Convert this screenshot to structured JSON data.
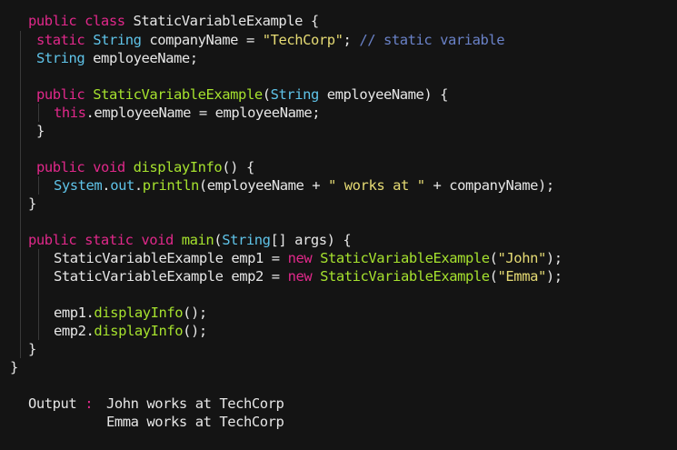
{
  "colors": {
    "background": "#141414",
    "keyword": "#e0288a",
    "type": "#5fc3e8",
    "function": "#a6e22e",
    "string": "#e6db74",
    "comment": "#6a82c8",
    "default_text": "#e6e6e6"
  },
  "code": {
    "l1": {
      "kw": "public class",
      "name": " StaticVariableExample {"
    },
    "l2": {
      "kw": "static",
      "ty": "String",
      "rest": " companyName = ",
      "str": "\"TechCorp\"",
      "semi": "; ",
      "comment": "// static variable"
    },
    "l3": {
      "ty": "String",
      "rest": " employeeName;"
    },
    "l4": {
      "kw": "public",
      "fn": "StaticVariableExample",
      "p1": "(",
      "ty": "String",
      "p2": " employeeName) {"
    },
    "l5": {
      "kw": "this",
      "rest": ".employeeName = employeeName;"
    },
    "l6": {
      "rest": "}"
    },
    "l7": {
      "kw": "public void",
      "fn": "displayInfo",
      "rest": "() {"
    },
    "l8": {
      "ty1": "System",
      "p1": ".",
      "ty2": "out",
      "p2": ".",
      "fn": "println",
      "p3": "(employeeName + ",
      "str": "\" works at \"",
      "p4": " + companyName);"
    },
    "l9": {
      "rest": "}"
    },
    "l10": {
      "kw": "public static void",
      "fn": "main",
      "p1": "(",
      "ty": "String",
      "p2": "[] args) {"
    },
    "l11": {
      "a": "StaticVariableExample emp1 = ",
      "kw": "new",
      "fn": "StaticVariableExample",
      "p": "(",
      "str": "\"John\"",
      "end": ");"
    },
    "l12": {
      "a": "StaticVariableExample emp2 = ",
      "kw": "new",
      "fn": "StaticVariableExample",
      "p": "(",
      "str": "\"Emma\"",
      "end": ");"
    },
    "l13": {
      "a": "emp1.",
      "fn": "displayInfo",
      "end": "();"
    },
    "l14": {
      "a": "emp2.",
      "fn": "displayInfo",
      "end": "();"
    },
    "l15": {
      "rest": "}"
    },
    "l16": {
      "rest": "}"
    }
  },
  "output": {
    "label": "Output",
    "colon": ":",
    "line1": "John works at TechCorp",
    "line2": "Emma works at TechCorp"
  }
}
